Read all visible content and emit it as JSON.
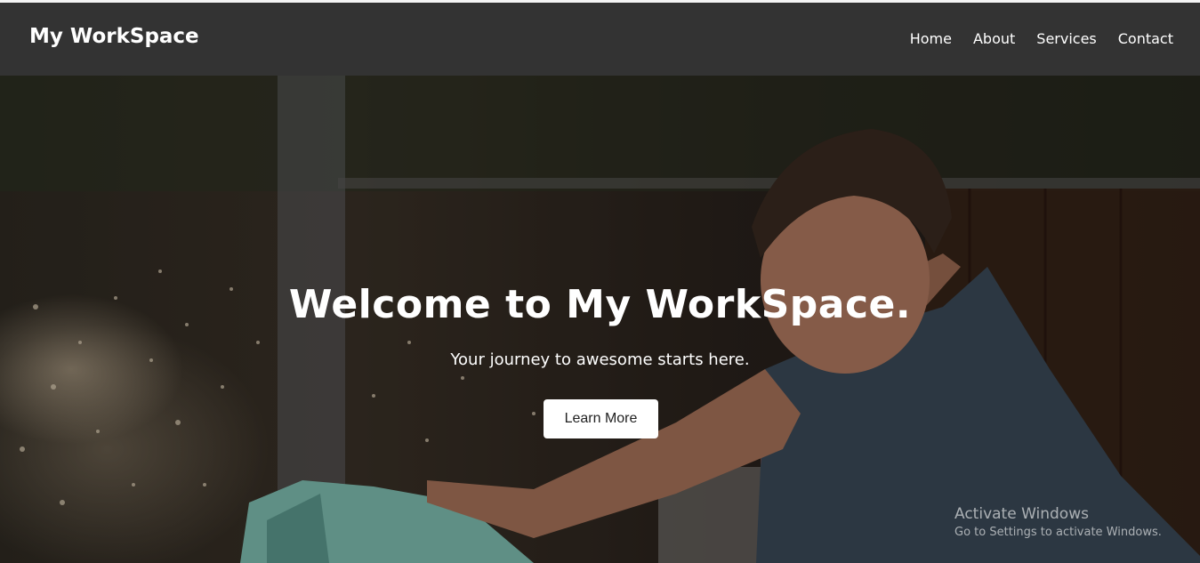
{
  "navbar": {
    "brand": "My WorkSpace",
    "links": [
      {
        "label": "Home"
      },
      {
        "label": "About"
      },
      {
        "label": "Services"
      },
      {
        "label": "Contact"
      }
    ]
  },
  "hero": {
    "title": "Welcome to My WorkSpace.",
    "subtitle": "Your journey to awesome starts here.",
    "button_label": "Learn More"
  },
  "watermark": {
    "title": "Activate Windows",
    "subtitle": "Go to Settings to activate Windows."
  },
  "colors": {
    "navbar_bg": "#333333",
    "nav_text": "#ffffff",
    "button_bg": "#ffffff",
    "button_text": "#222222"
  }
}
